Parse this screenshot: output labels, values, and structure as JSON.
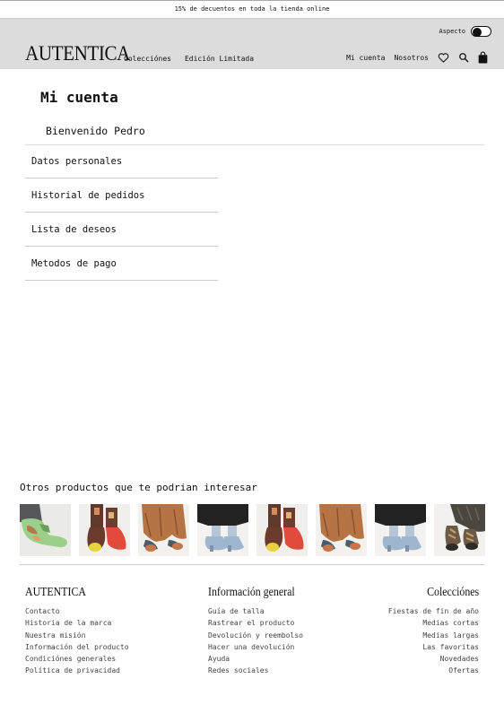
{
  "promo": {
    "text": "15% de decuentos en toda la tienda online"
  },
  "header": {
    "logo": "AUTENTICA",
    "aspect_label": "Aspecto",
    "nav_left": [
      "Colecciónes",
      "Edición Limitada"
    ],
    "nav_right": [
      "Mi cuenta",
      "Nosotros"
    ],
    "icons": [
      "heart-icon",
      "search-icon",
      "bag-icon"
    ]
  },
  "account": {
    "title": "Mi cuenta",
    "welcome": "Bienvenido Pedro",
    "menu": [
      "Datos personales",
      "Historial de pedidos",
      "Lista de deseos",
      "Metodos de pago"
    ]
  },
  "recommendations": {
    "title": "Otros productos que te podrian interesar",
    "products": [
      {
        "name": "green-socks"
      },
      {
        "name": "red-pattern-socks"
      },
      {
        "name": "brown-pants-socks"
      },
      {
        "name": "blue-shoes-socks"
      },
      {
        "name": "red-pattern-socks"
      },
      {
        "name": "brown-pants-socks"
      },
      {
        "name": "blue-shoes-socks"
      },
      {
        "name": "dark-pattern-socks"
      }
    ]
  },
  "footer": {
    "brand": {
      "title": "AUTENTICA",
      "links": [
        "Contacto",
        "Historia de la marca",
        "Nuestra misión",
        "Información del producto",
        "Condiciónes generales",
        "Política de privacidad"
      ]
    },
    "info": {
      "title": "Información general",
      "links": [
        "Guía de talla",
        "Rastrear el producto",
        "Devolución y reembolso",
        "Hacer una devolución",
        "Ayuda",
        "Redes sociales"
      ]
    },
    "collections": {
      "title": "Colecciónes",
      "links": [
        "Fiestas de fin de año",
        "Medias cortas",
        "Medias largas",
        "Las favoritas",
        "Novedades",
        "Ofertas"
      ]
    }
  }
}
